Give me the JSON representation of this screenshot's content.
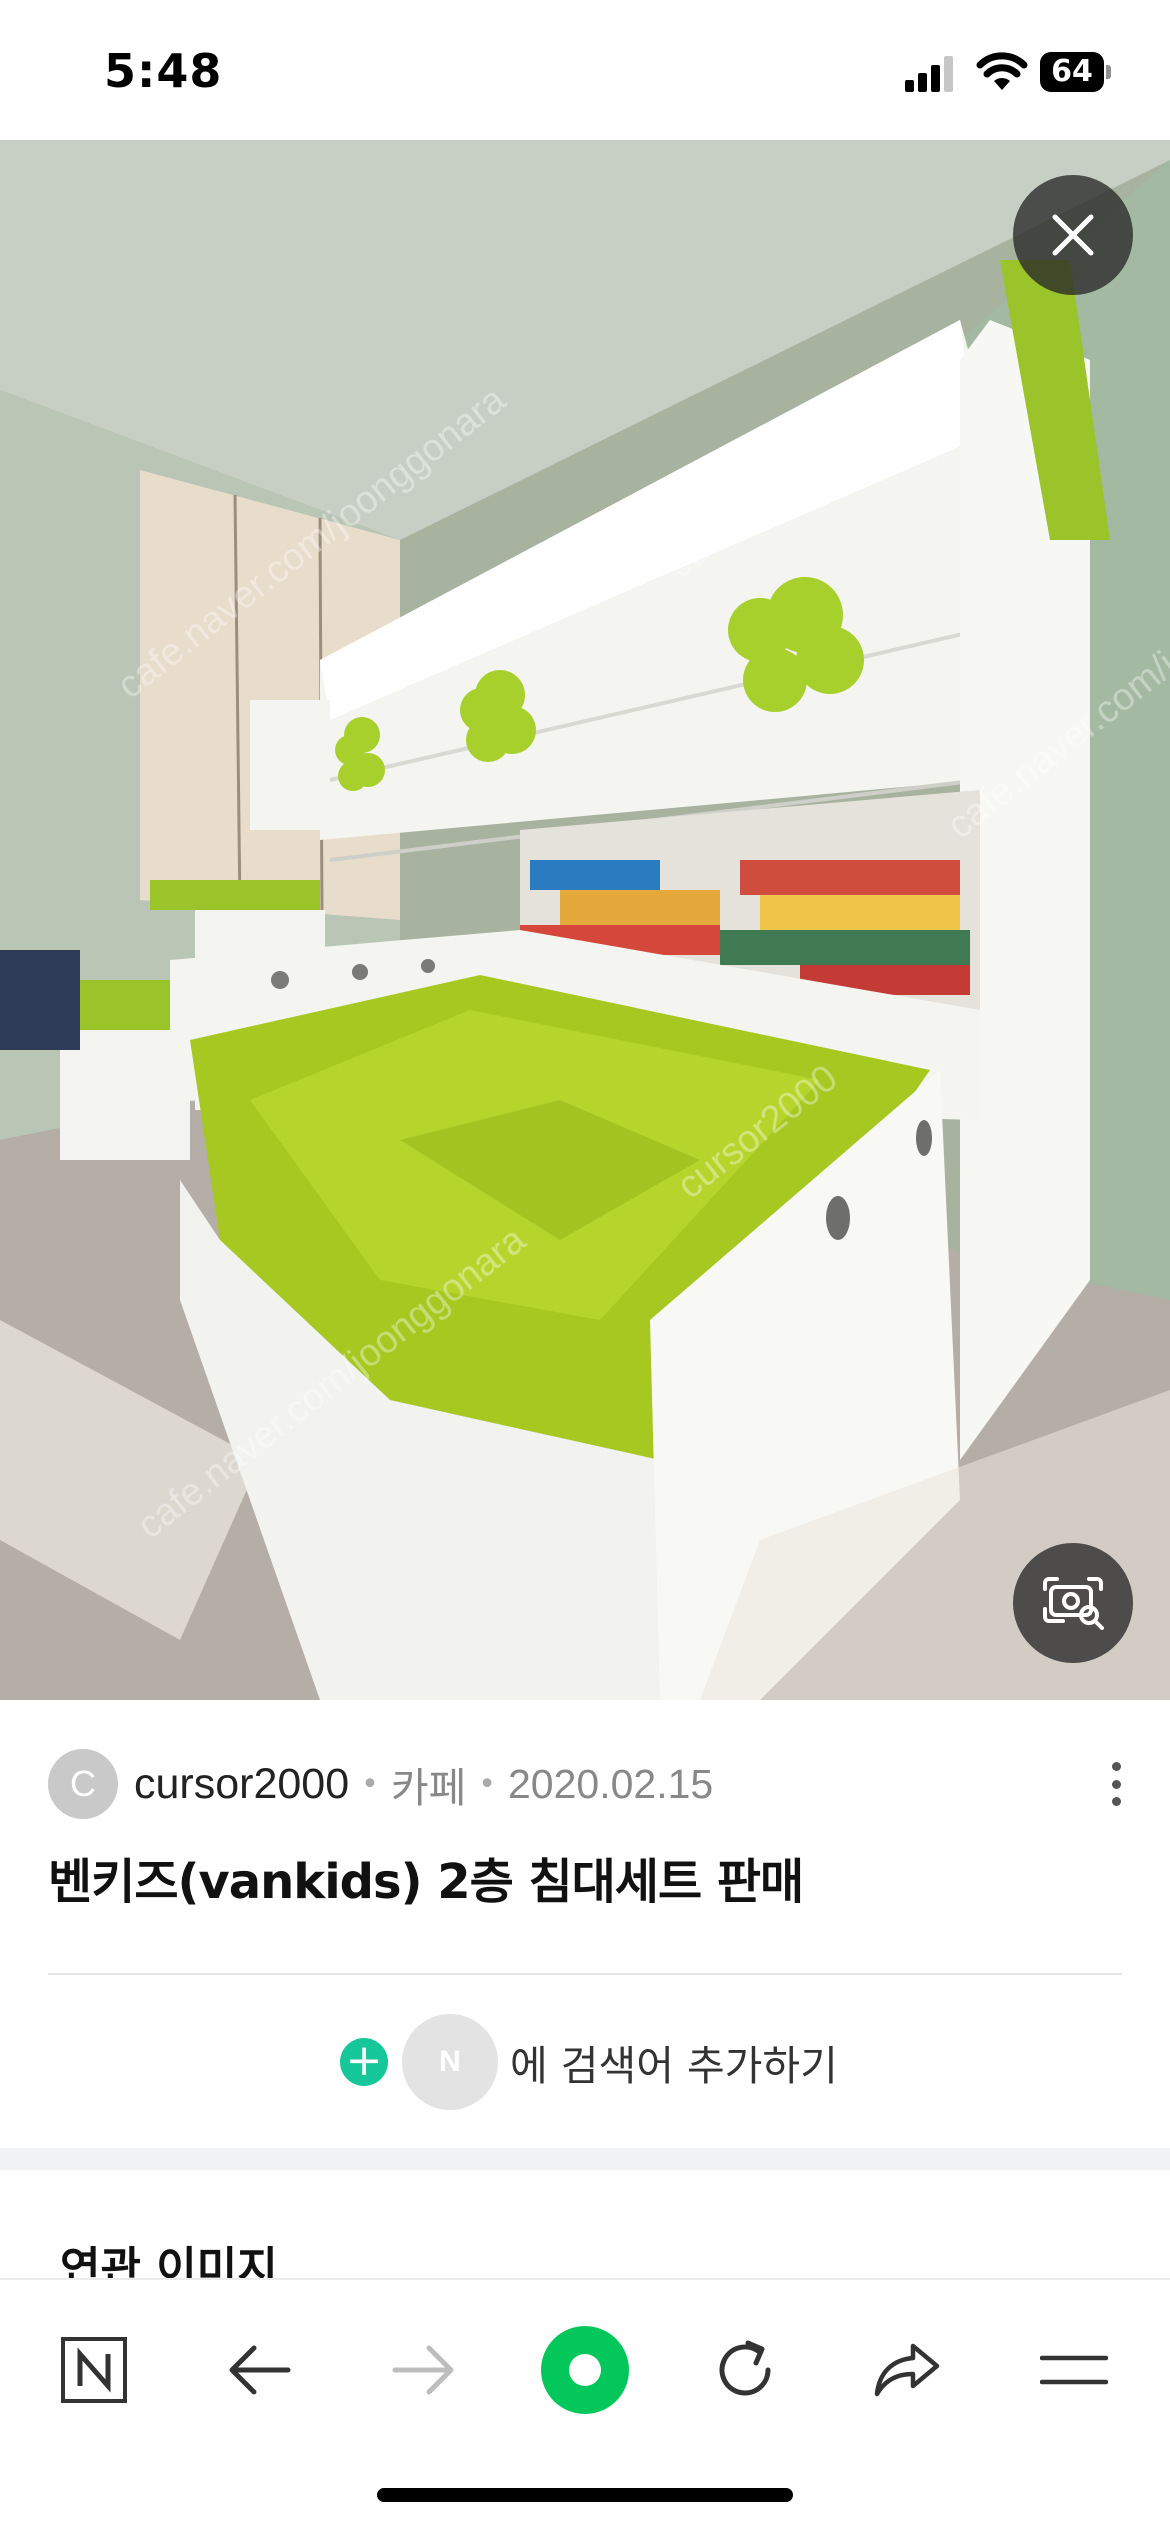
{
  "status_bar": {
    "time": "5:48",
    "battery": "64"
  },
  "photo": {
    "watermark_1": "cafe.naver.com/joonggonara",
    "watermark_2": "cursor2000",
    "close_icon": "close-icon",
    "lens_icon": "image-search-icon"
  },
  "post": {
    "avatar_letter": "C",
    "author": "cursor2000",
    "separator": "•",
    "source": "카페",
    "date": "2020.02.15",
    "title": "벤키즈(vankids) 2층 침대세트 판매"
  },
  "add_search": {
    "avatar_letter": "N",
    "label": "에 검색어 추가하기"
  },
  "related": {
    "title": "연관 이미지"
  },
  "toolbar": {
    "home": "naver-home-icon",
    "back": "back-arrow-icon",
    "forward": "forward-arrow-icon",
    "green_dot": "green-dot-icon",
    "reload": "reload-icon",
    "share": "share-icon",
    "menu": "menu-icon"
  },
  "colors": {
    "accent_green": "#03c75a",
    "plus_green": "#16c79a"
  }
}
